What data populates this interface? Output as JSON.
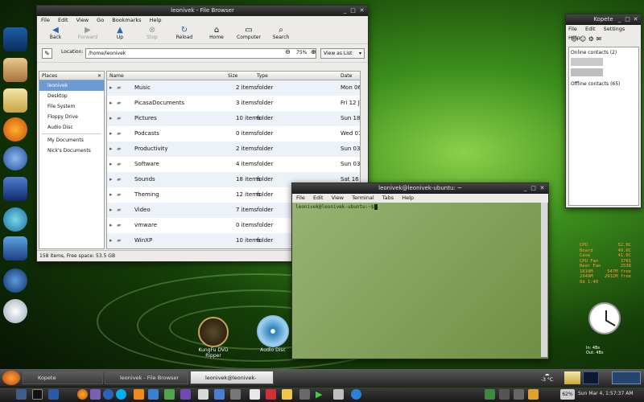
{
  "file_browser": {
    "title": "leonivek - File Browser",
    "menu": [
      "File",
      "Edit",
      "View",
      "Go",
      "Bookmarks",
      "Help"
    ],
    "toolbar": [
      {
        "label": "Back",
        "icon": "back-arrow-icon",
        "enabled": true
      },
      {
        "label": "Forward",
        "icon": "forward-arrow-icon",
        "enabled": false
      },
      {
        "label": "Up",
        "icon": "up-arrow-icon",
        "enabled": true
      },
      {
        "label": "Stop",
        "icon": "stop-icon",
        "enabled": false
      },
      {
        "label": "Reload",
        "icon": "reload-icon",
        "enabled": true
      },
      {
        "label": "Home",
        "icon": "home-icon",
        "enabled": true
      },
      {
        "label": "Computer",
        "icon": "computer-icon",
        "enabled": true
      },
      {
        "label": "Search",
        "icon": "search-icon",
        "enabled": true
      }
    ],
    "location_label": "Location:",
    "location_value": "/home/leonivek",
    "zoom": "75%",
    "view_mode": "View as List",
    "places_header": "Places",
    "places": [
      "leonivek",
      "Desktop",
      "File System",
      "Floppy Drive",
      "Audio Disc",
      "My Documents",
      "Nick's Documents"
    ],
    "columns": [
      "Name",
      "Size",
      "Type",
      "Date Mod"
    ],
    "rows": [
      {
        "name": "Music",
        "size": "2 items",
        "type": "folder",
        "date": "Mon 06"
      },
      {
        "name": "PicasaDocuments",
        "size": "3 items",
        "type": "folder",
        "date": "Fri 12 Ja"
      },
      {
        "name": "Pictures",
        "size": "10 items",
        "type": "folder",
        "date": "Sun 18 F"
      },
      {
        "name": "Podcasts",
        "size": "0 items",
        "type": "folder",
        "date": "Wed 01 I"
      },
      {
        "name": "Productivity",
        "size": "2 items",
        "type": "folder",
        "date": "Sun 03 D"
      },
      {
        "name": "Software",
        "size": "4 items",
        "type": "folder",
        "date": "Sun 03 D"
      },
      {
        "name": "Sounds",
        "size": "18 items",
        "type": "folder",
        "date": "Sat 16 D"
      },
      {
        "name": "Theming",
        "size": "12 items",
        "type": "folder",
        "date": "Sun 03 D"
      },
      {
        "name": "Video",
        "size": "7 items",
        "type": "folder",
        "date": "Sun 03 D"
      },
      {
        "name": "vmware",
        "size": "0 items",
        "type": "folder",
        "date": "Sun 03 D"
      },
      {
        "name": "WinXP",
        "size": "10 items",
        "type": "folder",
        "date": "Sun 03 D"
      }
    ],
    "status": "158 items, Free space: 53.5 GB"
  },
  "terminal": {
    "title": "leonivek@leonivek-ubuntu: ~",
    "menu": [
      "File",
      "Edit",
      "View",
      "Terminal",
      "Tabs",
      "Help"
    ],
    "prompt": "leonivek@leonivek-ubuntu:~$"
  },
  "kopete": {
    "title": "Kopete",
    "menu": [
      "File",
      "Edit",
      "Settings",
      "Help"
    ],
    "online_header": "Online contacts (2)",
    "offline_header": "Offline contacts (65)"
  },
  "sysmon": [
    {
      "label": "CPU",
      "value": "52.0C"
    },
    {
      "label": "Board",
      "value": "40.0C"
    },
    {
      "label": "Case",
      "value": "41.0C"
    },
    {
      "label": "CPU Fan",
      "value": "3701"
    },
    {
      "label": "Rear Fan",
      "value": "2538"
    },
    {
      "label": "1810M",
      "value": "547M free"
    },
    {
      "label": "2949M",
      "value": "2932M free"
    },
    {
      "label": "0d 1:40",
      "value": ""
    }
  ],
  "netmon": {
    "in_label": "In: 4Bs",
    "out_label": "Out: 4Bs"
  },
  "desktop_icons": [
    "KungFu DVD Ripper",
    "Audio Disc"
  ],
  "taskbar": {
    "tasks": [
      "Kopete",
      "leonivek - File Browser",
      "leonivek@leonivek-ubuntu: ~"
    ],
    "active_task": 2,
    "weather": "-3 °C",
    "clock": "Sun Mar 4, 1:57:37 AM",
    "battery": "62%"
  },
  "colors": {
    "accent": "#6b9bd4",
    "panel": "#2b2b2b",
    "sysmon_text": "#ff9a3c"
  }
}
